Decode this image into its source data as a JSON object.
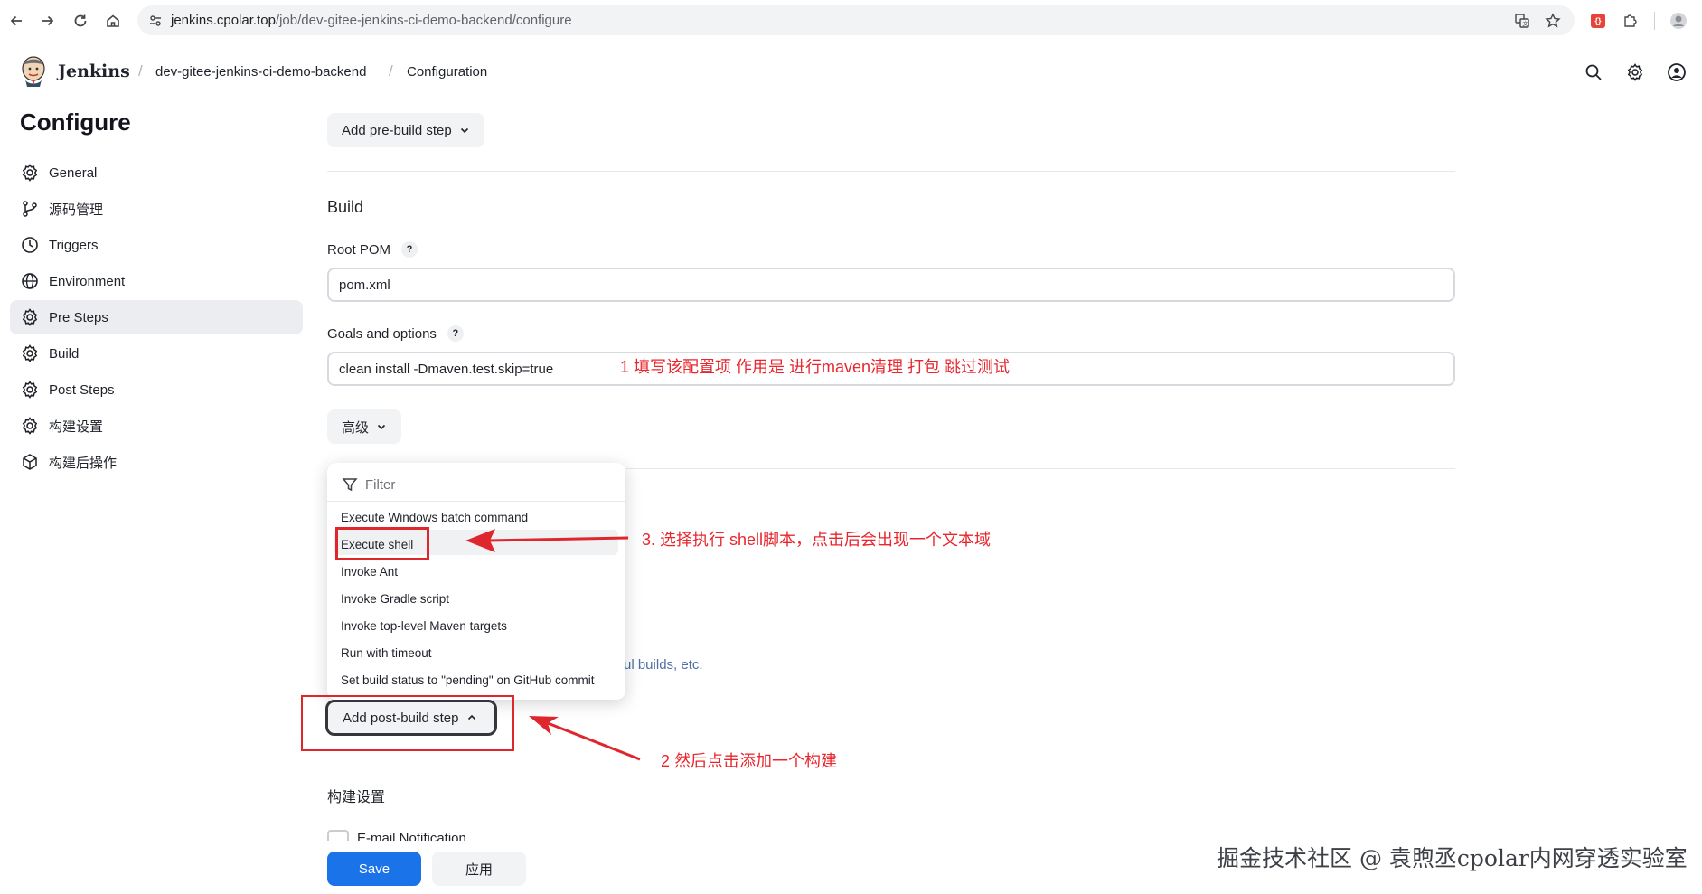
{
  "browser": {
    "url_host": "jenkins.cpolar.top",
    "url_path": "/job/dev-gitee-jenkins-ci-demo-backend/configure"
  },
  "header": {
    "brand": "Jenkins",
    "breadcrumbs": [
      "dev-gitee-jenkins-ci-demo-backend",
      "Configuration"
    ]
  },
  "sidebar": {
    "title": "Configure",
    "items": [
      {
        "label": "General",
        "icon": "gear-icon"
      },
      {
        "label": "源码管理",
        "icon": "git-branch-icon"
      },
      {
        "label": "Triggers",
        "icon": "clock-icon"
      },
      {
        "label": "Environment",
        "icon": "globe-icon"
      },
      {
        "label": "Pre Steps",
        "icon": "gear-icon",
        "active": true
      },
      {
        "label": "Build",
        "icon": "gear-icon"
      },
      {
        "label": "Post Steps",
        "icon": "gear-icon"
      },
      {
        "label": "构建设置",
        "icon": "gear-icon"
      },
      {
        "label": "构建后操作",
        "icon": "package-icon"
      }
    ]
  },
  "main": {
    "pre_build_button": "Add pre-build step",
    "build_section_title": "Build",
    "root_pom_label": "Root POM",
    "root_pom_value": "pom.xml",
    "goals_label": "Goals and options",
    "goals_value": "clean install -Dmaven.test.skip=true",
    "help_glyph": "?",
    "advanced_button": "高级",
    "behind_text": "ul builds, etc.",
    "post_build_button": "Add post-build step",
    "build_settings_title": "构建设置",
    "email_checkbox_label": "E-mail Notification"
  },
  "menu": {
    "filter_placeholder": "Filter",
    "items": [
      "Execute Windows batch command",
      "Execute shell",
      "Invoke Ant",
      "Invoke Gradle script",
      "Invoke top-level Maven targets",
      "Run with timeout",
      "Set build status to \"pending\" on GitHub commit"
    ]
  },
  "actions": {
    "save": "Save",
    "apply": "应用"
  },
  "annotations": {
    "note1": "1 填写该配置项  作用是 进行maven清理 打包 跳过测试",
    "note2": "2 然后点击添加一个构建",
    "note3": "3. 选择执行 shell脚本，点击后会出现一个文本域"
  },
  "watermark": "掘金技术社区 @ 袁煦丞cpolar内网穿透实验室",
  "colors": {
    "accent": "#1a73e8",
    "annotation_red": "#e8262d",
    "active_item_bg": "#ebedf0"
  }
}
